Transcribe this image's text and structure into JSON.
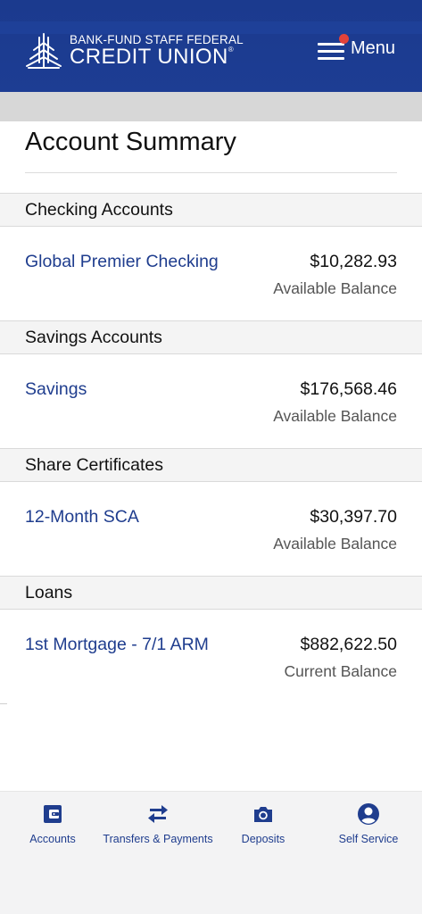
{
  "header": {
    "logo_top": "BANK-FUND STAFF FEDERAL",
    "logo_bottom": "CREDIT UNION",
    "logo_reg": "®",
    "menu_label": "Menu",
    "brand_color": "#1d3d93",
    "notification_color": "#e2423a"
  },
  "page": {
    "title": "Account Summary"
  },
  "sections": [
    {
      "header": "Checking Accounts",
      "account": {
        "name": "Global Premier Checking",
        "amount": "$10,282.93",
        "label": "Available Balance"
      }
    },
    {
      "header": "Savings Accounts",
      "account": {
        "name": "Savings",
        "amount": "$176,568.46",
        "label": "Available Balance"
      }
    },
    {
      "header": "Share Certificates",
      "account": {
        "name": "12-Month SCA",
        "amount": "$30,397.70",
        "label": "Available Balance"
      }
    },
    {
      "header": "Loans",
      "account": {
        "name": "1st Mortgage - 7/1 ARM",
        "amount": "$882,622.50",
        "label": "Current Balance"
      }
    }
  ],
  "tabbar": {
    "items": [
      {
        "label": "Accounts",
        "icon": "wallet-icon"
      },
      {
        "label": "Transfers & Payments",
        "icon": "transfer-arrows-icon"
      },
      {
        "label": "Deposits",
        "icon": "camera-icon"
      },
      {
        "label": "Self Service",
        "icon": "user-circle-icon"
      }
    ]
  }
}
